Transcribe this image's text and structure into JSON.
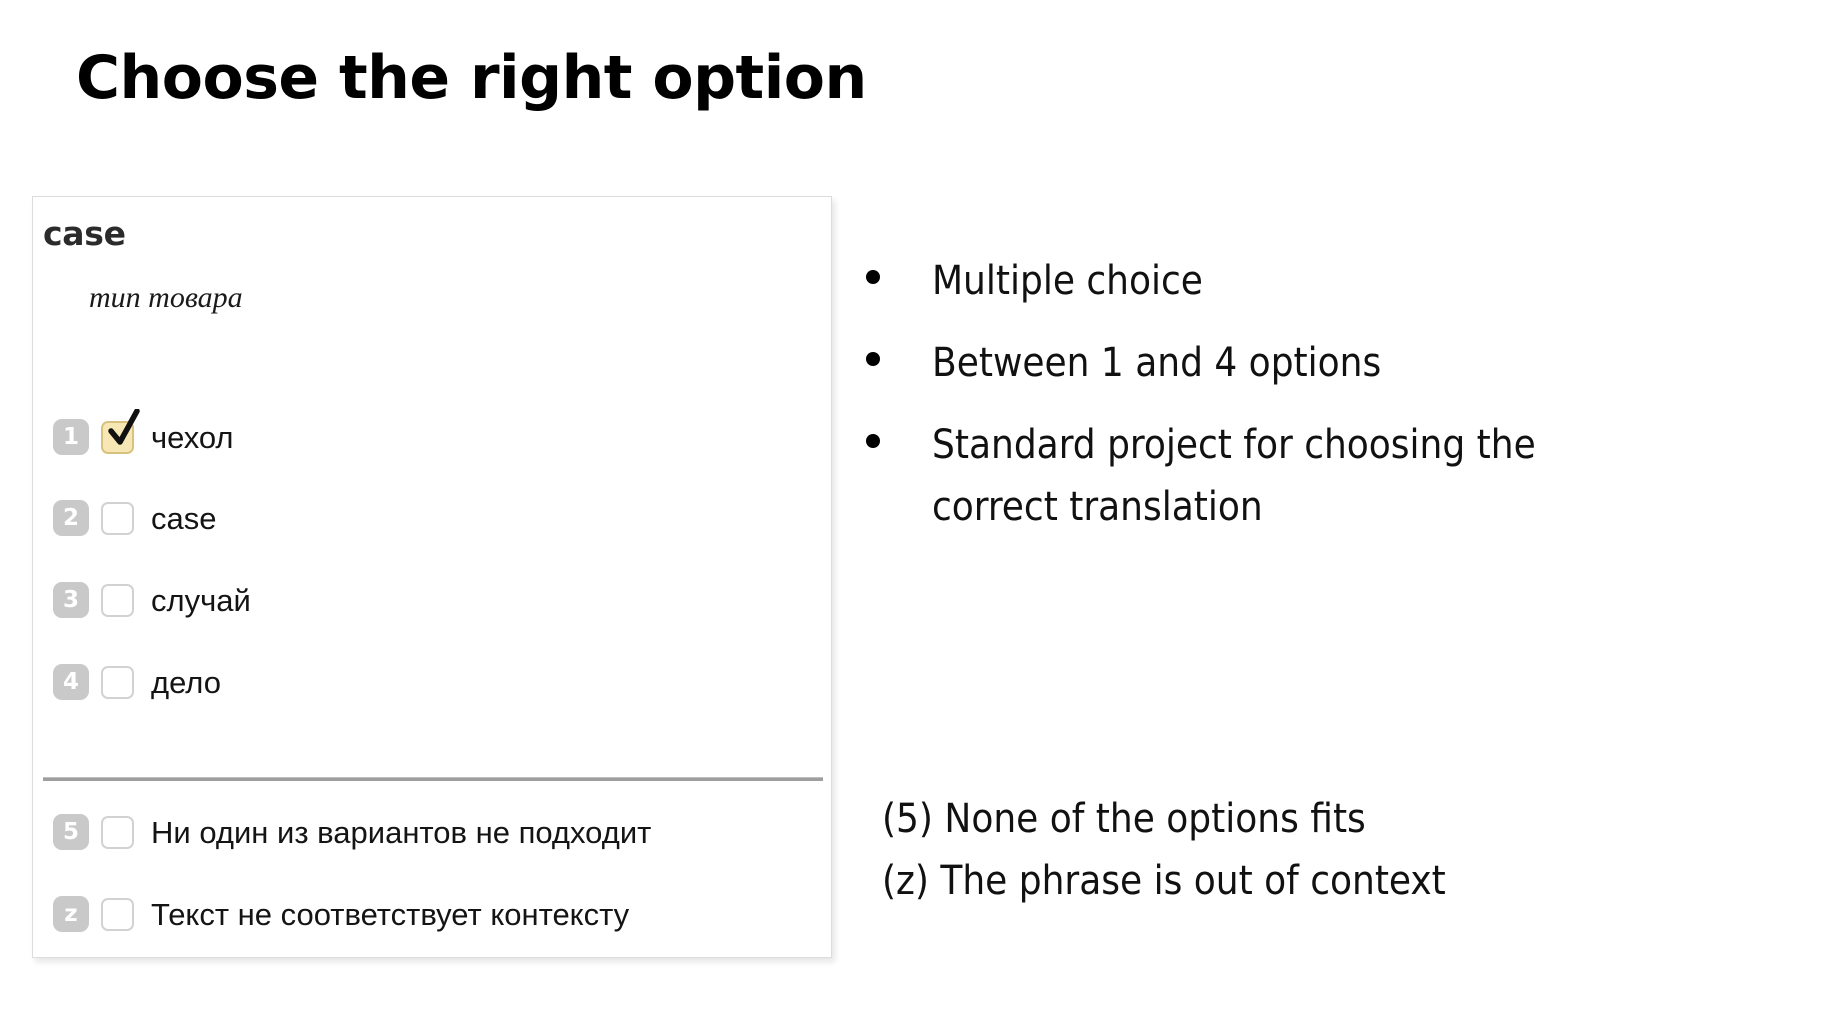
{
  "slide": {
    "title": "Choose the right option"
  },
  "exercise_panel": {
    "headword": "case",
    "gloss": "тип товара",
    "options": [
      {
        "key": "1",
        "label": "чехол",
        "checked": true
      },
      {
        "key": "2",
        "label": "case",
        "checked": false
      },
      {
        "key": "3",
        "label": "случай",
        "checked": false
      },
      {
        "key": "4",
        "label": "дело",
        "checked": false
      }
    ],
    "fallback_options": [
      {
        "key": "5",
        "label": "Ни один из вариантов не подходит",
        "checked": false
      },
      {
        "key": "z",
        "label": "Текст не соответствует контексту",
        "checked": false
      }
    ]
  },
  "description": {
    "bullets": [
      "Multiple choice",
      "Between 1 and 4 options",
      "Standard project for choosing the correct translation"
    ],
    "notes": [
      "(5) None of the options fits",
      "(z) The phrase is out of context"
    ]
  },
  "colors": {
    "checked_fill": "#f7e7b4",
    "checked_border": "#d8c280",
    "badge": "#c9c9c9",
    "panel_border": "#dcdcdc",
    "text": "#111111"
  }
}
